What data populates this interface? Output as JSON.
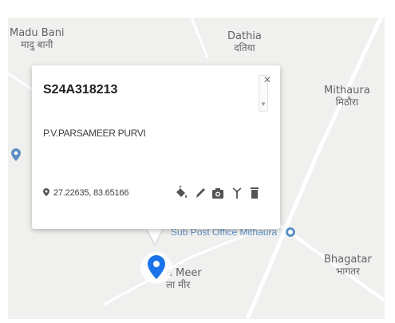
{
  "map": {
    "places": [
      {
        "id": "madu-bani",
        "en": "Madu Bani",
        "hi": "मादु बानी"
      },
      {
        "id": "dathia",
        "en": "Dathia",
        "hi": "दतिया"
      },
      {
        "id": "mithaura",
        "en": "Mithaura",
        "hi": "मिठौरा"
      },
      {
        "id": "bhagatar",
        "en": "Bhagatar",
        "hi": "भागतर"
      },
      {
        "id": "meer",
        "en": "a Meer",
        "hi": "ला मीर"
      }
    ],
    "poi": {
      "label": "Sub Post Office Mithaura",
      "icon": "post-office-icon"
    },
    "colors": {
      "land": "#f0f0ee",
      "road": "#ffffff",
      "poi": "#5d8fc2",
      "marker": "#1a73e8"
    }
  },
  "popup": {
    "title": "S24A318213",
    "name": "P.V.PARSAMEER PURVI",
    "coordinates": "27.22635, 83.65166",
    "close_label": "×",
    "tools": [
      "paint-bucket-icon",
      "pencil-icon",
      "camera-icon",
      "tower-icon",
      "trash-icon"
    ]
  }
}
